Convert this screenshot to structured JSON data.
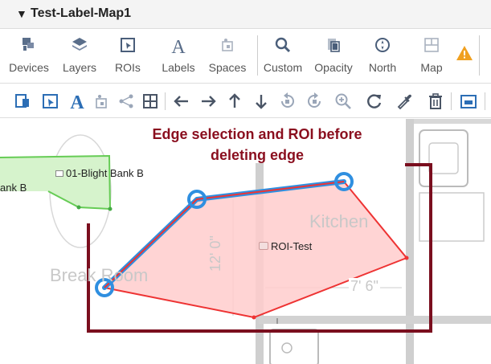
{
  "panel": {
    "title": "Test-Label-Map1",
    "collapse_glyph": "▼"
  },
  "toolbar": {
    "buttons": [
      {
        "id": "devices",
        "label": "Devices",
        "icon": "devices-icon"
      },
      {
        "id": "layers",
        "label": "Layers",
        "icon": "layers-icon"
      },
      {
        "id": "rois",
        "label": "ROIs",
        "icon": "roi-icon"
      },
      {
        "id": "labels",
        "label": "Labels",
        "icon": "text-label-icon"
      },
      {
        "id": "spaces",
        "label": "Spaces",
        "icon": "spaces-icon"
      },
      {
        "id": "custom",
        "label": "Custom",
        "icon": "search-icon"
      },
      {
        "id": "opacity",
        "label": "Opacity",
        "icon": "opacity-icon"
      },
      {
        "id": "north",
        "label": "North",
        "icon": "compass-icon"
      },
      {
        "id": "map",
        "label": "Map",
        "icon": "map-icon"
      }
    ],
    "warning_icon": "warning-icon",
    "labels_glyph": "A"
  },
  "edit_toolbar": {
    "tools": [
      "add-device-icon",
      "add-roi-icon",
      "add-label-icon",
      "add-space-icon",
      "share-nodes-icon",
      "grid-icon",
      "arrow-left-icon",
      "arrow-right-icon",
      "arrow-up-icon",
      "arrow-down-icon",
      "rotate-left-icon",
      "rotate-right-icon",
      "zoom-in-icon",
      "reset-icon",
      "eyedropper-icon",
      "trash-icon",
      "window-icon"
    ],
    "text_tool_glyph": "A"
  },
  "map": {
    "annotation_line1": "Edge selection and ROI before",
    "annotation_line2": "deleting edge",
    "roi_label": "ROI-Test",
    "device_label": "01-Blight Bank B",
    "left_label": "ank B",
    "room_kitchen": "Kitchen",
    "room_break": "Break Room",
    "dim_vertical": "12' 0\"",
    "dim_horizontal": "7' 6\"",
    "colors": {
      "annotation": "#8a0e1e",
      "roi_fill": "#ffcccc",
      "roi_stroke": "#ee3333",
      "selection": "#2f8fe0",
      "green_zone": "#66cc55",
      "warning": "#f0a020"
    }
  }
}
